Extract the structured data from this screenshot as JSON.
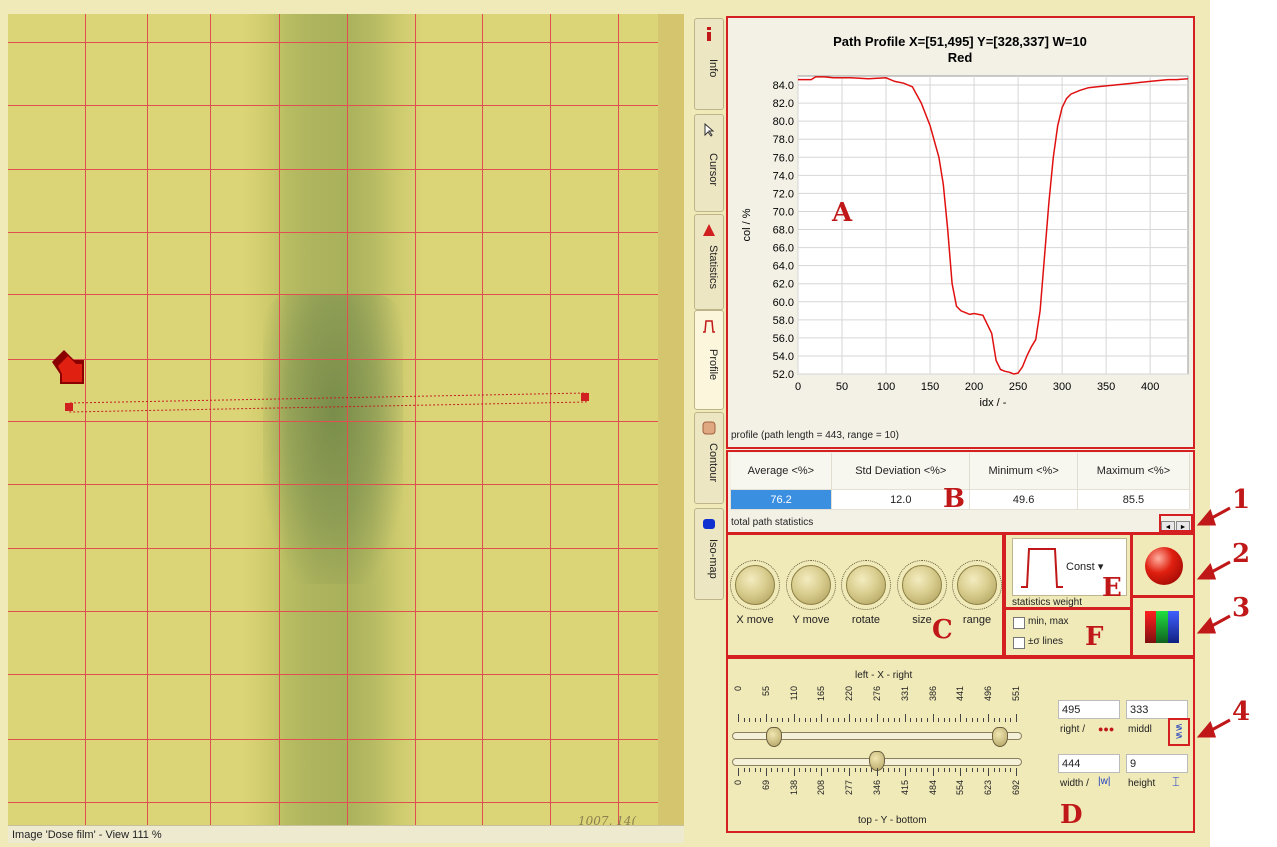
{
  "image_view": {
    "status": "Image 'Dose film' - View  111 %",
    "film_mark": "1007, 14("
  },
  "tabs": [
    {
      "label": "Info"
    },
    {
      "label": "Cursor"
    },
    {
      "label": "Statistics"
    },
    {
      "label": "Profile"
    },
    {
      "label": "Contour"
    },
    {
      "label": "Iso-map"
    }
  ],
  "chart": {
    "title_line1": "Path Profile X=[51,495] Y=[328,337] W=10",
    "title_line2": "Red",
    "caption": "profile (path length = 443, range = 10)",
    "colors": {
      "line": "#e01010",
      "grid": "#d6d6d6",
      "plot_bg": "#ffffff"
    }
  },
  "chart_data": {
    "type": "line",
    "title": "Path Profile X=[51,495] Y=[328,337] W=10",
    "subtitle": "Red",
    "xlabel": "idx / -",
    "ylabel": "col / %",
    "xlim": [
      0,
      443
    ],
    "ylim": [
      52,
      85
    ],
    "x_ticks": [
      "0",
      "50",
      "100",
      "150",
      "200",
      "250",
      "300",
      "350",
      "400"
    ],
    "y_ticks": [
      "52.0",
      "54.0",
      "56.0",
      "58.0",
      "60.0",
      "62.0",
      "64.0",
      "66.0",
      "68.0",
      "70.0",
      "72.0",
      "74.0",
      "76.0",
      "78.0",
      "80.0",
      "82.0",
      "84.0"
    ],
    "grid": true,
    "series": [
      {
        "x": [
          0,
          15,
          20,
          30,
          40,
          60,
          80,
          100,
          110,
          120,
          130,
          140,
          150,
          160,
          165,
          170,
          175,
          180,
          185,
          190,
          195,
          200,
          210,
          220,
          225,
          230,
          235,
          240,
          245,
          250,
          255,
          260,
          265,
          270,
          275,
          280,
          285,
          290,
          295,
          300,
          305,
          310,
          320,
          330,
          340,
          350,
          360,
          370,
          380,
          390,
          400,
          410,
          420,
          430,
          443
        ],
        "y": [
          84.6,
          84.6,
          84.9,
          84.9,
          84.8,
          84.8,
          84.7,
          84.8,
          84.4,
          84.2,
          83.8,
          82.0,
          79.5,
          76.0,
          73.0,
          68.0,
          62.0,
          59.5,
          59.0,
          58.8,
          58.6,
          58.7,
          58.5,
          56.5,
          53.5,
          52.5,
          52.3,
          52.2,
          52.0,
          52.1,
          52.8,
          54.0,
          55.0,
          55.8,
          59.0,
          65.0,
          71.0,
          76.0,
          79.5,
          81.5,
          82.5,
          83.0,
          83.4,
          83.7,
          83.8,
          83.9,
          84.0,
          84.1,
          84.2,
          84.3,
          84.4,
          84.5,
          84.6,
          84.6,
          84.7
        ]
      }
    ]
  },
  "stats": {
    "headers": [
      "Average <%>",
      "Std Deviation <%>",
      "Minimum <%>",
      "Maximum <%>"
    ],
    "values": [
      "76.2",
      "12.0",
      "49.6",
      "85.5"
    ],
    "caption": "total path statistics"
  },
  "knobs": [
    "X move",
    "Y move",
    "rotate",
    "size",
    "range"
  ],
  "weight": {
    "value": "Const",
    "caption": "statistics weight"
  },
  "checks": [
    {
      "label": "min, max"
    },
    {
      "label": "±σ lines"
    }
  ],
  "slider": {
    "x_title": "left - X - right",
    "y_title": "top - Y - bottom",
    "x_ticks": [
      "0",
      "55",
      "110",
      "165",
      "220",
      "276",
      "331",
      "386",
      "441",
      "496",
      "551"
    ],
    "y_ticks": [
      "0",
      "69",
      "138",
      "208",
      "277",
      "346",
      "415",
      "484",
      "554",
      "623",
      "692"
    ],
    "x_thumb_a": 0.05,
    "x_thumb_b": 0.9,
    "y_thumb": 0.5
  },
  "fields": {
    "right": {
      "value": "495",
      "label": "right /"
    },
    "middle": {
      "value": "333",
      "label": "middl"
    },
    "width": {
      "value": "444",
      "label": "width /"
    },
    "height": {
      "value": "9",
      "label": "height"
    }
  },
  "annotations": {
    "letters": [
      "A",
      "B",
      "C",
      "D",
      "E",
      "F"
    ],
    "numbers": [
      "1",
      "2",
      "3",
      "4"
    ]
  }
}
